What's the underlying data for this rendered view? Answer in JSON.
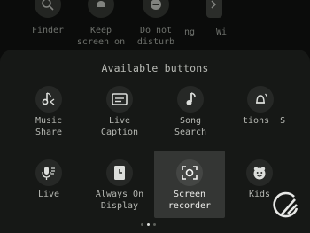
{
  "top_row": [
    {
      "label": "Finder",
      "icon": "search-icon"
    },
    {
      "label": "Keep\nscreen on",
      "icon": "bell-icon"
    },
    {
      "label": "Do not\ndisturb",
      "icon": "dnd-icon"
    },
    {
      "label": "ng",
      "icon": "none"
    },
    {
      "label": "Wi",
      "icon": "exit-icon"
    }
  ],
  "panel": {
    "title": "Available buttons",
    "row1": [
      {
        "label": "Music\nShare",
        "icon": "music-share-icon"
      },
      {
        "label": "Live\nCaption",
        "icon": "caption-icon"
      },
      {
        "label": "Song\nSearch",
        "icon": "music-note-icon"
      },
      {
        "label": "tions  S",
        "icon": "bell-wave-icon"
      }
    ],
    "row2": [
      {
        "label": "Live",
        "icon": "mic-icon"
      },
      {
        "label": "Always On\nDisplay",
        "icon": "clock-icon"
      },
      {
        "label": "Screen\nrecorder",
        "icon": "screen-record-icon",
        "selected": true
      },
      {
        "label": "Kids",
        "icon": "kids-face-icon"
      }
    ]
  },
  "page_indicator": {
    "pages": 3,
    "active": 2
  }
}
